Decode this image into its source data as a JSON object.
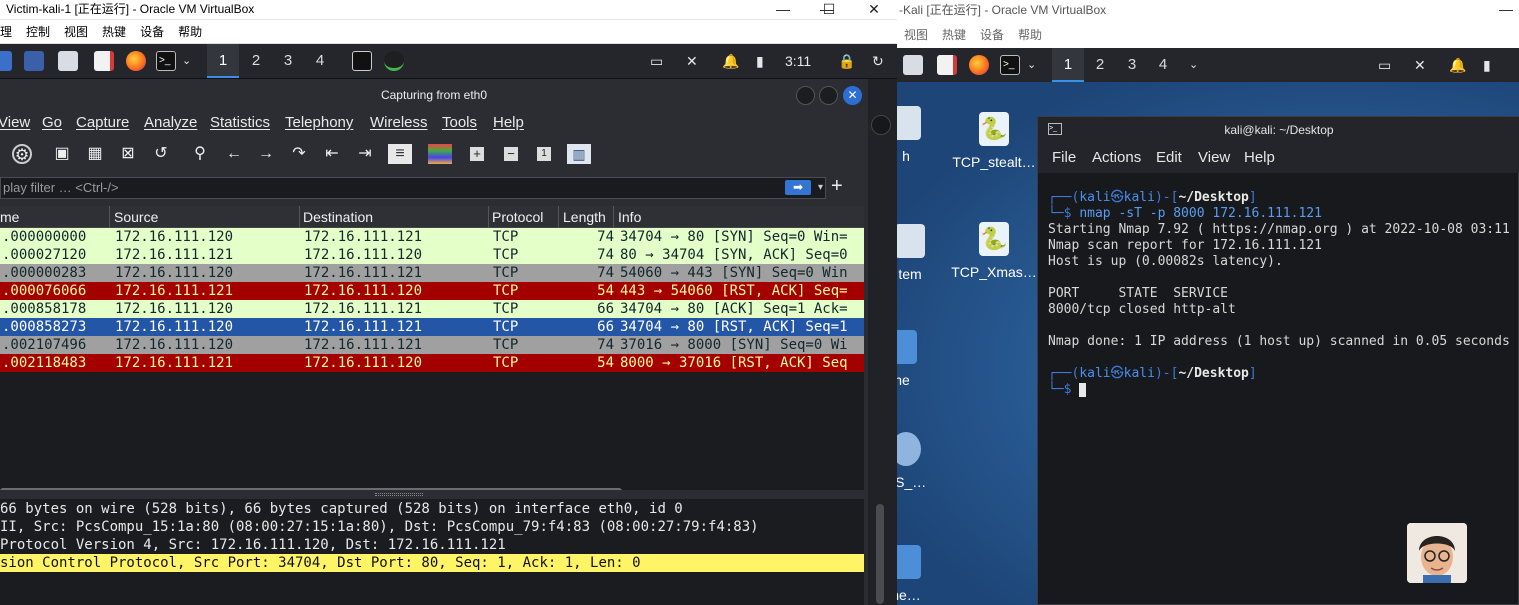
{
  "left_vm": {
    "title": "Victim-kali-1 [正在运行] - Oracle VM VirtualBox",
    "menu": [
      "理",
      "控制",
      "视图",
      "热键",
      "设备",
      "帮助"
    ],
    "panel": {
      "workspaces": [
        "1",
        "2",
        "3",
        "4"
      ],
      "clock": "3:11"
    },
    "wireshark": {
      "window_title": "Capturing from eth0",
      "menu": [
        "View",
        "Go",
        "Capture",
        "Analyze",
        "Statistics",
        "Telephony",
        "Wireless",
        "Tools",
        "Help"
      ],
      "filter_placeholder": "play filter … <Ctrl-/>",
      "columns": [
        "me",
        "Source",
        "Destination",
        "Protocol",
        "Length",
        "Info"
      ],
      "packets": [
        {
          "time": ".000000000",
          "src": "172.16.111.120",
          "dst": "172.16.111.121",
          "proto": "TCP",
          "len": "74",
          "info": "34704 → 80 [SYN] Seq=0 Win=",
          "bg": "#e4ffc7",
          "fg": "#12272e"
        },
        {
          "time": ".000027120",
          "src": "172.16.111.121",
          "dst": "172.16.111.120",
          "proto": "TCP",
          "len": "74",
          "info": "80 → 34704 [SYN, ACK] Seq=0",
          "bg": "#e4ffc7",
          "fg": "#12272e"
        },
        {
          "time": ".000000283",
          "src": "172.16.111.120",
          "dst": "172.16.111.121",
          "proto": "TCP",
          "len": "74",
          "info": "54060 → 443 [SYN] Seq=0 Win",
          "bg": "#a0a0a0",
          "fg": "#12272e"
        },
        {
          "time": ".000076066",
          "src": "172.16.111.121",
          "dst": "172.16.111.120",
          "proto": "TCP",
          "len": "54",
          "info": "443 → 54060 [RST, ACK] Seq=",
          "bg": "#a40000",
          "fg": "#fffc9c"
        },
        {
          "time": ".000858178",
          "src": "172.16.111.120",
          "dst": "172.16.111.121",
          "proto": "TCP",
          "len": "66",
          "info": "34704 → 80 [ACK] Seq=1 Ack=",
          "bg": "#e4ffc7",
          "fg": "#12272e"
        },
        {
          "time": ".000858273",
          "src": "172.16.111.120",
          "dst": "172.16.111.121",
          "proto": "TCP",
          "len": "66",
          "info": "34704 → 80 [RST, ACK] Seq=1",
          "bg": "#2456a8",
          "fg": "#ffffff"
        },
        {
          "time": ".002107496",
          "src": "172.16.111.120",
          "dst": "172.16.111.121",
          "proto": "TCP",
          "len": "74",
          "info": "37016 → 8000 [SYN] Seq=0 Wi",
          "bg": "#a0a0a0",
          "fg": "#12272e"
        },
        {
          "time": ".002118483",
          "src": "172.16.111.121",
          "dst": "172.16.111.120",
          "proto": "TCP",
          "len": "54",
          "info": "8000 → 37016 [RST, ACK] Seq",
          "bg": "#a40000",
          "fg": "#fffc9c"
        }
      ],
      "details": [
        " 66 bytes on wire (528 bits), 66 bytes captured (528 bits) on interface eth0, id 0",
        " II, Src: PcsCompu_15:1a:80 (08:00:27:15:1a:80), Dst: PcsCompu_79:f4:83 (08:00:27:79:f4:83)",
        " Protocol Version 4, Src: 172.16.111.120, Dst: 172.16.111.121",
        "sion Control Protocol, Src Port: 34704, Dst Port: 80, Seq: 1, Ack: 1, Len: 0"
      ]
    }
  },
  "right_vm": {
    "title": "-Kali [正在运行] - Oracle VM VirtualBox",
    "menu": [
      "视图",
      "热键",
      "设备",
      "帮助"
    ],
    "panel": {
      "workspaces": [
        "1",
        "2",
        "3",
        "4"
      ]
    },
    "desktop_icons": [
      "h",
      "TCP_stealt…",
      "tem",
      "TCP_Xmas…",
      "ne",
      "AS_…",
      "ne…"
    ],
    "terminal": {
      "title": "kali@kali: ~/Desktop",
      "menu": [
        "File",
        "Actions",
        "Edit",
        "View",
        "Help"
      ],
      "prompt_user": "kali",
      "prompt_at": "㉿",
      "prompt_host": "kali",
      "prompt_dir": "~/Desktop",
      "command": "nmap -sT -p 8000 172.16.111.121",
      "output": [
        "Starting Nmap 7.92 ( https://nmap.org ) at 2022-10-08 03:11",
        "Nmap scan report for 172.16.111.121",
        "Host is up (0.00082s latency).",
        "",
        "PORT     STATE  SERVICE",
        "8000/tcp closed http-alt",
        "",
        "Nmap done: 1 IP address (1 host up) scanned in 0.05 seconds"
      ]
    }
  }
}
